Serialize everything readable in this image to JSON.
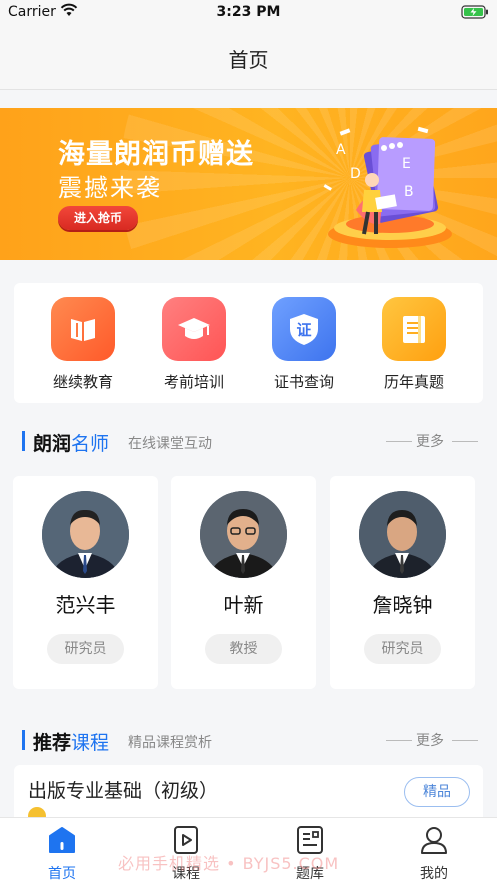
{
  "status_bar": {
    "carrier": "Carrier",
    "time": "3:23 PM"
  },
  "nav": {
    "title": "首页"
  },
  "banner": {
    "headline": "海量朗润币赠送",
    "subline": "震撼来袭",
    "cta": "进入抢币",
    "art_letters": [
      "A",
      "D",
      "E",
      "B"
    ]
  },
  "quick_access": [
    {
      "label": "继续教育",
      "icon": "book-icon",
      "color": "#ff6b3d"
    },
    {
      "label": "考前培训",
      "icon": "graduation-cap-icon",
      "color": "#ff6464"
    },
    {
      "label": "证书查询",
      "icon": "certificate-shield-icon",
      "glyph": "证",
      "color": "#4e86f5"
    },
    {
      "label": "历年真题",
      "icon": "document-icon",
      "color": "#ffb020"
    }
  ],
  "teachers_section": {
    "title_black": "朗润",
    "title_blue": "名师",
    "subtitle": "在线课堂互动",
    "more": "更多"
  },
  "teachers": [
    {
      "name": "范兴丰",
      "title": "研究员"
    },
    {
      "name": "叶新",
      "title": "教授"
    },
    {
      "name": "詹晓钟",
      "title": "研究员"
    }
  ],
  "courses_section": {
    "title_black": "推荐",
    "title_blue": "课程",
    "subtitle": "精品课程赏析",
    "more": "更多"
  },
  "course": {
    "title": "出版专业基础（初级）",
    "badge": "精品"
  },
  "tabs": [
    {
      "label": "首页",
      "icon": "home-icon",
      "active": true
    },
    {
      "label": "课程",
      "icon": "play-video-icon",
      "active": false
    },
    {
      "label": "题库",
      "icon": "question-bank-icon",
      "active": false
    },
    {
      "label": "我的",
      "icon": "profile-icon",
      "active": false
    }
  ],
  "watermark": "必用手机精选 • BYJS5.COM",
  "colors": {
    "accent": "#1e74f0",
    "banner": "#ffa21a",
    "cta": "#e0322a"
  }
}
